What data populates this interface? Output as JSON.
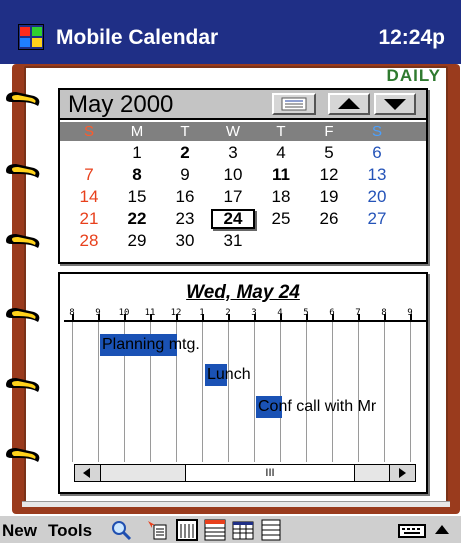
{
  "titlebar": {
    "app_title": "Mobile Calendar",
    "clock": "12:24p"
  },
  "view_label": "DAILY",
  "month": {
    "title": "May 2000",
    "weekdays": [
      "S",
      "M",
      "T",
      "W",
      "T",
      "F",
      "S"
    ],
    "weeks": [
      [
        "",
        "1",
        "2",
        "3",
        "4",
        "5",
        "6"
      ],
      [
        "7",
        "8",
        "9",
        "10",
        "11",
        "12",
        "13"
      ],
      [
        "14",
        "15",
        "16",
        "17",
        "18",
        "19",
        "20"
      ],
      [
        "21",
        "22",
        "23",
        "24",
        "25",
        "26",
        "27"
      ],
      [
        "28",
        "29",
        "30",
        "31",
        "",
        "",
        ""
      ]
    ],
    "bold_days": [
      "2",
      "8",
      "11",
      "22",
      "24"
    ],
    "selected_day": "24"
  },
  "day": {
    "title": "Wed, May 24",
    "hours": [
      "8",
      "9",
      "10",
      "11",
      "12",
      "1",
      "2",
      "3",
      "4",
      "5",
      "6",
      "7",
      "8",
      "9"
    ],
    "events": [
      {
        "text": "Planning mtg.",
        "highlight_chars": 8
      },
      {
        "text": "Lunch",
        "highlight_chars": 2
      },
      {
        "text": "Conf call with Mr",
        "highlight_chars": 2
      }
    ],
    "scroll_thumb_label": "III"
  },
  "cmdbar": {
    "new_label": "New",
    "tools_label": "Tools",
    "icons": [
      "search-icon",
      "goto-today-icon",
      "day-view-icon",
      "week-view-icon",
      "month-view-icon",
      "agenda-view-icon",
      "keyboard-icon",
      "up-arrow-icon"
    ]
  },
  "colors": {
    "titlebar": "#1f2f86",
    "binder": "#9a3b1d",
    "daily_label": "#2f7a2f",
    "sunday": "#e8401c",
    "saturday": "#2453b8",
    "event_highlight": "#1a52b5"
  }
}
